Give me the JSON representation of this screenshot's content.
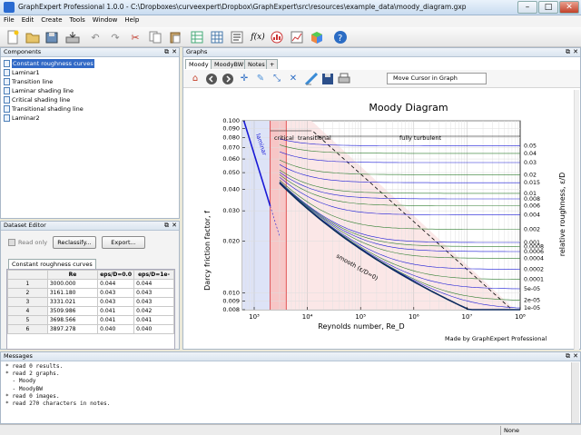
{
  "window": {
    "title": "GraphExpert Professional 1.0.0 - C:\\Dropboxes\\curveexpert\\Dropbox\\GraphExpert\\src\\resources\\example_data\\moody_diagram.gxp",
    "min": "–",
    "max": "□",
    "close": "✕"
  },
  "menu": [
    "File",
    "Edit",
    "Create",
    "Tools",
    "Window",
    "Help"
  ],
  "toolbar_icons": [
    "new-document-icon",
    "open-folder-icon",
    "save-disk-icon",
    "import-icon",
    "undo-icon",
    "redo-icon",
    "cut-icon",
    "copy-icon",
    "paste-icon",
    "new-dataset-icon",
    "table-icon",
    "text-icon",
    "function-icon",
    "histogram-icon",
    "chart-icon",
    "color-cube-icon",
    "help-icon"
  ],
  "components": {
    "title": "Components",
    "items": [
      "Constant roughness curves",
      "Laminar1",
      "Transition line",
      "Laminar shading line",
      "Critical shading line",
      "Transitional shading line",
      "Laminar2"
    ],
    "selected": 0
  },
  "dataset_editor": {
    "title": "Dataset Editor",
    "read_only_label": "Read only",
    "reclassify_label": "Reclassify...",
    "export_label": "Export...",
    "tab": "Constant roughness curves",
    "columns": [
      "Re",
      "eps/D=0.0",
      "eps/D=1e-"
    ],
    "rows": [
      [
        "1",
        "3000.000",
        "0.044",
        "0.044"
      ],
      [
        "2",
        "3161.180",
        "0.043",
        "0.043"
      ],
      [
        "3",
        "3331.021",
        "0.043",
        "0.043"
      ],
      [
        "4",
        "3509.986",
        "0.041",
        "0.042"
      ],
      [
        "5",
        "3698.566",
        "0.041",
        "0.041"
      ],
      [
        "6",
        "3897.278",
        "0.040",
        "0.040"
      ]
    ]
  },
  "graphs": {
    "title": "Graphs",
    "tabs": [
      "Moody",
      "MoodyBW",
      "Notes",
      "+"
    ],
    "active_tab": 0,
    "cursor_button": "Move Cursor in Graph"
  },
  "chart_data": {
    "type": "line",
    "title": "Moody Diagram",
    "xlabel": "Reynolds number, Re_D",
    "ylabel": "Darcy friction factor, f",
    "y2label": "relative roughness, ε/D",
    "xscale": "log",
    "yscale": "log",
    "xlim": [
      600,
      100000000
    ],
    "ylim": [
      0.008,
      0.1
    ],
    "yticks": [
      "0.100",
      "0.090",
      "0.080",
      "0.070",
      "0.060",
      "0.050",
      "0.040",
      "0.030",
      "0.020",
      "0.010",
      "0.009",
      "0.008"
    ],
    "xticks": [
      "10³",
      "10⁴",
      "10⁵",
      "10⁶",
      "10⁷",
      "10⁸"
    ],
    "roughness_labels": [
      "0.05",
      "0.04",
      "0.03",
      "0.02",
      "0.015",
      "0.01",
      "0.008",
      "0.006",
      "0.004",
      "0.002",
      "0.001",
      "0.0008",
      "0.0006",
      "0.0004",
      "0.0002",
      "0.0001",
      "5e-05",
      "2e-05",
      "1e-05"
    ],
    "region_labels": {
      "laminar": "laminar",
      "critical": "critical",
      "transitional": "transitional",
      "turbulent": "fully turbulent",
      "smooth": "smooth (ε/D=0)"
    },
    "credit": "Made by GraphExpert Professional",
    "colors": {
      "curves_a": "#1a1ad6",
      "curves_b": "#2e7d2e",
      "laminar_fill": "#dde3f7",
      "critical_fill": "#f7c6c6",
      "transitional_fill": "#fbe7e7"
    }
  },
  "messages": {
    "title": "Messages",
    "lines": [
      "* read 0 results.",
      "* read 2 graphs.",
      "  - Moody",
      "  - MoodyBW",
      "* read 0 images.",
      "* read 270 characters in notes."
    ]
  },
  "status": {
    "right": "None"
  }
}
